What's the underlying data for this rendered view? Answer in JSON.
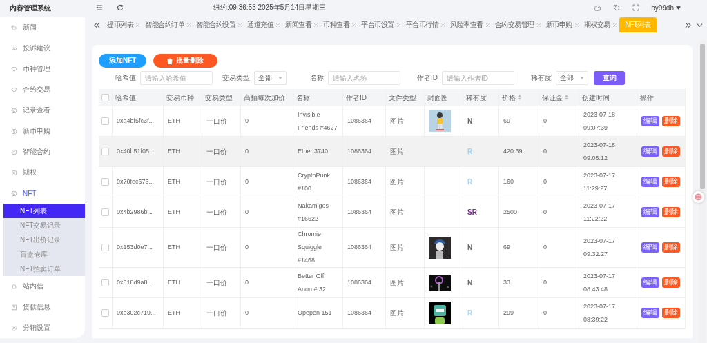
{
  "app": {
    "title": "内容管理系统"
  },
  "sidebar": {
    "items": [
      {
        "label": "新闻",
        "selected": false
      },
      {
        "label": "投诉建议",
        "selected": false
      },
      {
        "label": "币种管理",
        "selected": false
      },
      {
        "label": "合约交易",
        "selected": false
      },
      {
        "label": "记录查看",
        "selected": false
      },
      {
        "label": "新币申购",
        "selected": false
      },
      {
        "label": "智能合约",
        "selected": false
      },
      {
        "label": "期权",
        "selected": false
      },
      {
        "label": "NFT",
        "selected": true,
        "expanded": true,
        "children": [
          {
            "label": "NFT列表",
            "selected": true
          },
          {
            "label": "NFT交易记录",
            "selected": false
          },
          {
            "label": "NFT出价记录",
            "selected": false
          },
          {
            "label": "盲盒仓库",
            "selected": false
          },
          {
            "label": "NFT拍卖订单",
            "selected": false
          }
        ]
      },
      {
        "label": "站内信",
        "selected": false
      },
      {
        "label": "贷款信息",
        "selected": false
      },
      {
        "label": "分销设置",
        "selected": false
      }
    ]
  },
  "header": {
    "clock": "纽约:09:36:53 2025年5月14日星期三",
    "user": "by99dh"
  },
  "tabs": [
    {
      "label": "提币列表",
      "selected": false
    },
    {
      "label": "智能合约订单",
      "selected": false
    },
    {
      "label": "智能合约设置",
      "selected": false
    },
    {
      "label": "通道充值",
      "selected": false
    },
    {
      "label": "新闻查看",
      "selected": false
    },
    {
      "label": "币种查看",
      "selected": false
    },
    {
      "label": "平台币设置",
      "selected": false
    },
    {
      "label": "平台币行情",
      "selected": false
    },
    {
      "label": "风险率查看",
      "selected": false
    },
    {
      "label": "合约交易管理",
      "selected": false
    },
    {
      "label": "新币申购",
      "selected": false
    },
    {
      "label": "期权交易",
      "selected": false
    },
    {
      "label": "NFT列表",
      "selected": true
    }
  ],
  "toolbar": {
    "buttons": [
      {
        "label": "添加NFT",
        "kind": "primary"
      },
      {
        "label": "批量删除",
        "kind": "danger"
      }
    ]
  },
  "filters": [
    {
      "label": "哈希值",
      "kind": "input",
      "placeholder": "请输入哈希值"
    },
    {
      "label": "交易类型",
      "kind": "select",
      "value": "全部"
    },
    {
      "label": "名称",
      "kind": "input",
      "placeholder": "请输入名称"
    },
    {
      "label": "作者ID",
      "kind": "input",
      "placeholder": "请输入作者ID"
    },
    {
      "label": "稀有度",
      "kind": "select",
      "value": "全部"
    }
  ],
  "search_button": "查询",
  "table": {
    "select_all": {
      "checked": false
    },
    "columns": [
      {
        "label": "哈希值",
        "sortable": false
      },
      {
        "label": "交易币种",
        "sortable": false
      },
      {
        "label": "交易类型",
        "sortable": false
      },
      {
        "label": "高拍每次加价",
        "sortable": false
      },
      {
        "label": "名称",
        "sortable": false
      },
      {
        "label": "作者ID",
        "sortable": false
      },
      {
        "label": "文件类型",
        "sortable": false
      },
      {
        "label": "封面图",
        "sortable": false
      },
      {
        "label": "稀有度",
        "sortable": false
      },
      {
        "label": "价格",
        "sortable": true
      },
      {
        "label": "保证金",
        "sortable": true
      },
      {
        "label": "创建时间",
        "sortable": false
      },
      {
        "label": "操作",
        "sortable": false
      }
    ],
    "rows": [
      {
        "checked": false,
        "highlighted": false,
        "hash": "0xa4bf5fc3f...",
        "coin": "ETH",
        "trade_type": "一口价",
        "increment": "0",
        "name": "Invisible Friends #4627",
        "author_id": "1086364",
        "file_type": "图片",
        "rarity": {
          "label": "N",
          "color": "#666666"
        },
        "price": "69",
        "deposit": "0",
        "created": "2023-07-18 09:07:39",
        "actions": [
          "编辑",
          "删除"
        ]
      },
      {
        "checked": false,
        "highlighted": true,
        "hash": "0x40b51f05...",
        "coin": "ETH",
        "trade_type": "一口价",
        "increment": "0",
        "name": "Ether 3740",
        "author_id": "1086364",
        "file_type": "图片",
        "rarity": {
          "label": "R",
          "color": "#a9d3ef"
        },
        "price": "420.69",
        "deposit": "0",
        "created": "2023-07-18 09:05:12",
        "actions": [
          "编辑",
          "删除"
        ]
      },
      {
        "checked": false,
        "highlighted": false,
        "hash": "0x70fec676...",
        "coin": "ETH",
        "trade_type": "一口价",
        "increment": "0",
        "name": "CryptoPunk #100",
        "author_id": "1086364",
        "file_type": "图片",
        "rarity": {
          "label": "R",
          "color": "#a9d3ef"
        },
        "price": "160",
        "deposit": "0",
        "created": "2023-07-17 11:29:27",
        "actions": [
          "编辑",
          "删除"
        ]
      },
      {
        "checked": false,
        "highlighted": false,
        "hash": "0x4b2986b...",
        "coin": "ETH",
        "trade_type": "一口价",
        "increment": "0",
        "name": "Nakamigos #16622",
        "author_id": "1086364",
        "file_type": "图片",
        "rarity": {
          "label": "SR",
          "color": "#7a2b8c"
        },
        "price": "2500",
        "deposit": "0",
        "created": "2023-07-17 11:22:22",
        "actions": [
          "编辑",
          "删除"
        ]
      },
      {
        "checked": false,
        "highlighted": false,
        "hash": "0x153d0e7...",
        "coin": "ETH",
        "trade_type": "一口价",
        "increment": "0",
        "name": "Chromie Squiggle #1468",
        "author_id": "1086364",
        "file_type": "图片",
        "rarity": {
          "label": "N",
          "color": "#666666"
        },
        "price": "69",
        "deposit": "0",
        "created": "2023-07-17 09:32:27",
        "actions": [
          "编辑",
          "删除"
        ]
      },
      {
        "checked": false,
        "highlighted": false,
        "hash": "0x318d9a8...",
        "coin": "ETH",
        "trade_type": "一口价",
        "increment": "0",
        "name": "Better Off Anon # 32",
        "author_id": "1086364",
        "file_type": "图片",
        "rarity": {
          "label": "N",
          "color": "#666666"
        },
        "price": "33",
        "deposit": "0",
        "created": "2023-07-17 08:43:48",
        "actions": [
          "编辑",
          "删除"
        ]
      },
      {
        "checked": false,
        "highlighted": false,
        "hash": "0xb302c719...",
        "coin": "ETH",
        "trade_type": "一口价",
        "increment": "0",
        "name": "Opepen 151",
        "author_id": "1086364",
        "file_type": "图片",
        "rarity": {
          "label": "R",
          "color": "#a9d3ef"
        },
        "price": "299",
        "deposit": "0",
        "created": "2023-07-17 08:39:22",
        "actions": [
          "编辑",
          "删除"
        ]
      }
    ]
  }
}
